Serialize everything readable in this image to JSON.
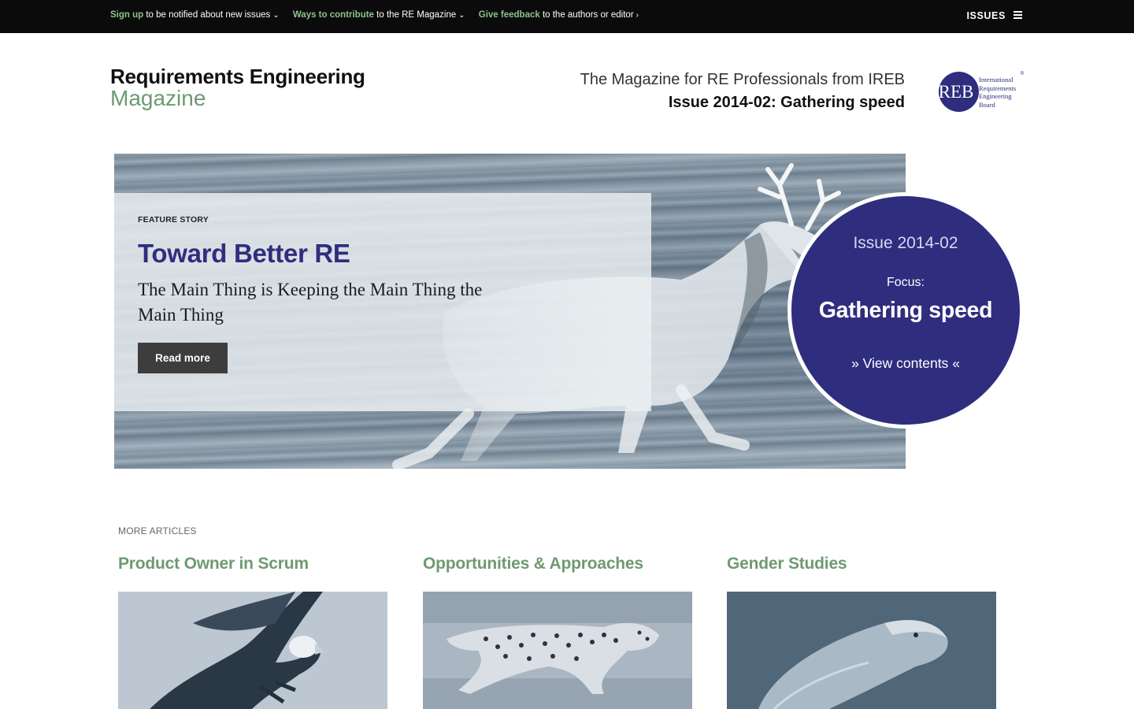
{
  "topbar": {
    "signup_link": "Sign up",
    "signup_text": " to be notified about new issues",
    "contribute_link": "Ways to contribute",
    "contribute_text": " to the RE Magazine",
    "feedback_link": "Give feedback",
    "feedback_text": " to the authors or editor",
    "issues_label": "ISSUES",
    "icons": [
      "chevron-down-icon",
      "chevron-down-icon",
      "chevron-right-icon",
      "hamburger-menu-icon"
    ]
  },
  "header": {
    "brand_line1": "Requirements Engineering",
    "brand_line2": "Magazine",
    "tagline": "The Magazine for RE Professionals from IREB",
    "issue_title": "Issue 2014-02: Gathering speed",
    "logo": {
      "letters": "IREB",
      "line1": "International",
      "line2": "Requirements",
      "line3": "Engineering",
      "line4": "Board",
      "registered": "®"
    }
  },
  "hero": {
    "kicker": "FEATURE STORY",
    "title": "Toward Better RE",
    "subtitle": "The Main Thing is Keeping the Main Thing the Main Thing",
    "button": "Read more",
    "issue_badge": {
      "issue": "Issue 2014-02",
      "focus_label": "Focus:",
      "topic": "Gathering speed",
      "view_contents": "View contents"
    }
  },
  "more_articles": {
    "label": "MORE ARTICLES",
    "items": [
      {
        "title": "Product Owner in Scrum"
      },
      {
        "title": "Opportunities & Approaches"
      },
      {
        "title": "Gender Studies"
      }
    ]
  },
  "colors": {
    "accent_blue": "#2f2d7e",
    "accent_green": "#6e9a71",
    "topbar_link_green": "#8fc08b",
    "topbar_bg": "#0b0b0b"
  }
}
